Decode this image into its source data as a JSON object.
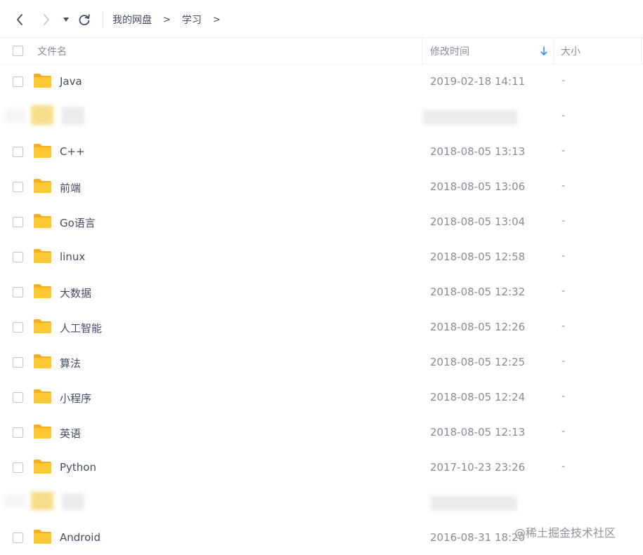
{
  "breadcrumb": {
    "root": "我的网盘",
    "sep1": ">",
    "current": "学习",
    "sep2": ">"
  },
  "header": {
    "name_label": "文件名",
    "modified_label": "修改时间",
    "size_label": "大小"
  },
  "rows": [
    {
      "name": "Java",
      "modified": "2019-02-18 14:11",
      "size": "-"
    },
    {
      "name": "",
      "modified": "",
      "size": "-"
    },
    {
      "name": "C++",
      "modified": "2018-08-05 13:13",
      "size": "-"
    },
    {
      "name": "前端",
      "modified": "2018-08-05 13:06",
      "size": "-"
    },
    {
      "name": "Go语言",
      "modified": "2018-08-05 13:04",
      "size": "-"
    },
    {
      "name": "linux",
      "modified": "2018-08-05 12:58",
      "size": "-"
    },
    {
      "name": "大数据",
      "modified": "2018-08-05 12:32",
      "size": "-"
    },
    {
      "name": "人工智能",
      "modified": "2018-08-05 12:26",
      "size": "-"
    },
    {
      "name": "算法",
      "modified": "2018-08-05 12:25",
      "size": "-"
    },
    {
      "name": "小程序",
      "modified": "2018-08-05 12:24",
      "size": "-"
    },
    {
      "name": "英语",
      "modified": "2018-08-05 12:13",
      "size": "-"
    },
    {
      "name": "Python",
      "modified": "2017-10-23 23:26",
      "size": "-"
    },
    {
      "name": "",
      "modified": "",
      "size": ""
    },
    {
      "name": "Android",
      "modified": "2016-08-31 18:20",
      "size": ""
    }
  ],
  "watermark": "@稀土掘金技术社区",
  "icons": {
    "back": "chevron-left-icon",
    "forward": "chevron-right-icon",
    "dropdown": "caret-down-icon",
    "refresh": "refresh-icon",
    "folder": "folder-icon",
    "sort": "arrow-down-icon"
  },
  "colors": {
    "folder": "#fcc934",
    "folder_tab": "#f4b01d",
    "sort_arrow": "#2d8cf0",
    "text": "#424e67",
    "muted": "#878c9c"
  }
}
